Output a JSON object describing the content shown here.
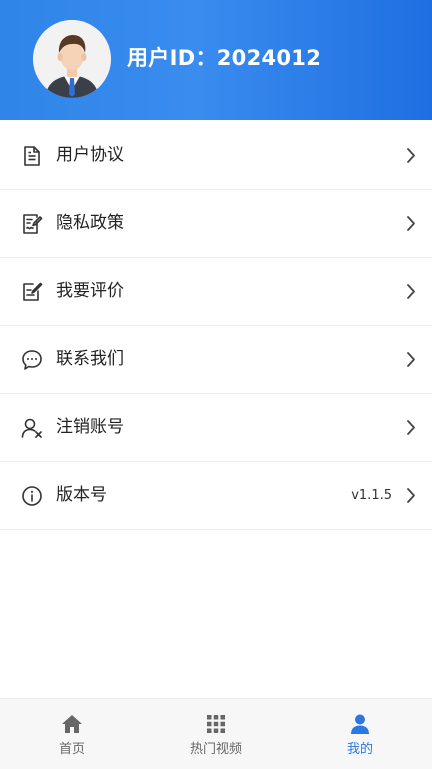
{
  "header": {
    "user_id_text": "用户ID：2024012"
  },
  "menu": {
    "items": [
      {
        "label": "用户协议",
        "icon": "document-icon",
        "value": ""
      },
      {
        "label": "隐私政策",
        "icon": "privacy-policy-icon",
        "value": ""
      },
      {
        "label": "我要评价",
        "icon": "edit-review-icon",
        "value": ""
      },
      {
        "label": "联系我们",
        "icon": "chat-bubble-icon",
        "value": ""
      },
      {
        "label": "注销账号",
        "icon": "user-remove-icon",
        "value": ""
      },
      {
        "label": "版本号",
        "icon": "info-icon",
        "value": "v1.1.5"
      }
    ]
  },
  "tabbar": {
    "tabs": [
      {
        "label": "首页",
        "icon": "home-icon",
        "active": false
      },
      {
        "label": "热门视频",
        "icon": "grid-icon",
        "active": false
      },
      {
        "label": "我的",
        "icon": "user-icon",
        "active": true
      }
    ]
  },
  "colors": {
    "header_gradient_start": "#2f85e8",
    "header_gradient_end": "#1e6fe1",
    "active_tab": "#2b78e4",
    "inactive_tab": "#666666"
  }
}
